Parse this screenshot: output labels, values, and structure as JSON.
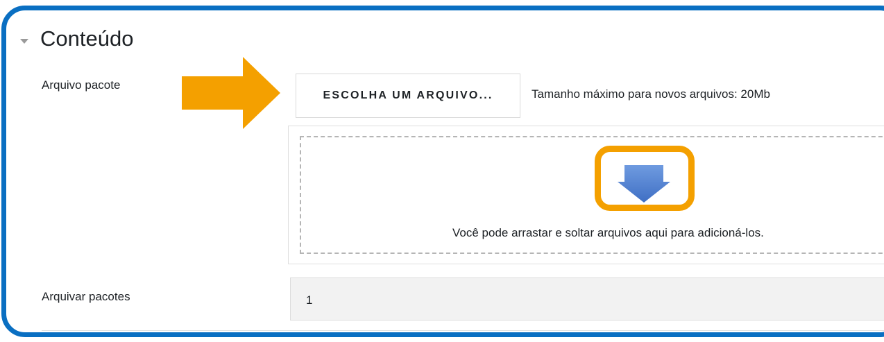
{
  "section": {
    "title": "Conteúdo"
  },
  "package_file": {
    "label": "Arquivo pacote",
    "choose_button": "ESCOLHA UM ARQUIVO...",
    "max_size_text": "Tamanho máximo para novos arquivos: 20Mb",
    "dropzone_text": "Você pode arrastar e soltar arquivos aqui para adicioná-los."
  },
  "archive_packages": {
    "label": "Arquivar pacotes",
    "value": "1"
  },
  "colors": {
    "frame": "#0a6fc2",
    "annotation": "#f4a000",
    "download_icon": "#4a7fcf"
  },
  "icons": {
    "section_toggle": "caret-down-icon",
    "annotation_arrow": "arrow-right-annotation-icon",
    "dropzone": "download-arrow-icon"
  }
}
